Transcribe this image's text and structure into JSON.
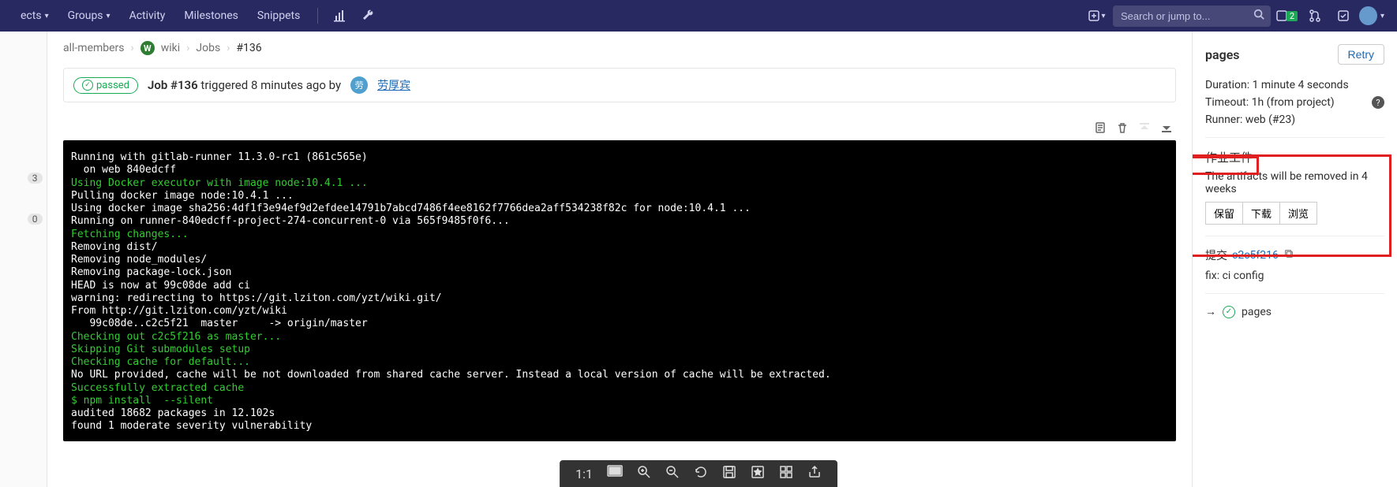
{
  "nav": {
    "projects": "ects",
    "groups": "Groups",
    "activity": "Activity",
    "milestones": "Milestones",
    "snippets": "Snippets"
  },
  "search": {
    "placeholder": "Search or jump to..."
  },
  "issues_badge": "2",
  "leftbar": {
    "b1": "3",
    "b2": "0"
  },
  "crumbs": {
    "c1": "all-members",
    "c2": "wiki",
    "c3": "Jobs",
    "c4": "#136",
    "proj_initial": "W"
  },
  "job": {
    "status": "passed",
    "title_prefix": "Job #136",
    "title_rest": " triggered 8 minutes ago by",
    "user_initial": "劳",
    "user": "劳厚宾"
  },
  "log": {
    "l1": "Running with gitlab-runner 11.3.0-rc1 (861c565e)",
    "l2": "  on web 840edcff",
    "l3": "Using Docker executor with image node:10.4.1 ...",
    "l4": "Pulling docker image node:10.4.1 ...",
    "l5": "Using docker image sha256:4df1f3e94ef9d2efdee14791b7abcd7486f4ee8162f7766dea2aff534238f82c for node:10.4.1 ...",
    "l6": "Running on runner-840edcff-project-274-concurrent-0 via 565f9485f0f6...",
    "l7": "Fetching changes...",
    "l8": "Removing dist/",
    "l9": "Removing node_modules/",
    "l10": "Removing package-lock.json",
    "l11": "HEAD is now at 99c08de add ci",
    "l12": "warning: redirecting to https://git.lziton.com/yzt/wiki.git/",
    "l13": "From http://git.lziton.com/yzt/wiki",
    "l14": "   99c08de..c2c5f21  master     -> origin/master",
    "l15": "Checking out c2c5f216 as master...",
    "l16": "Skipping Git submodules setup",
    "l17": "Checking cache for default...",
    "l18": "No URL provided, cache will be not downloaded from shared cache server. Instead a local version of cache will be extracted.",
    "l19": "Successfully extracted cache",
    "l20": "$ npm install  --silent",
    "l21": "audited 18682 packages in 12.102s",
    "l22": "found 1 moderate severity vulnerability"
  },
  "rsb": {
    "title": "pages",
    "retry": "Retry",
    "duration_lbl": "Duration: ",
    "duration_val": "1 minute 4 seconds",
    "timeout_lbl": "Timeout: ",
    "timeout_val": "1h (from project)",
    "runner_lbl": "Runner: ",
    "runner_val": "web (#23)",
    "artifacts_head": "作业工件",
    "artifacts_note": "The artifacts will be removed in 4 weeks",
    "btn_keep": "保留",
    "btn_download": "下载",
    "btn_browse": "浏览",
    "commit_lbl": "提交 ",
    "commit_sha": "c2c5f216",
    "commit_msg": "fix: ci config",
    "stage_name": "pages"
  },
  "status_bar": {
    "pos": "1:1"
  }
}
